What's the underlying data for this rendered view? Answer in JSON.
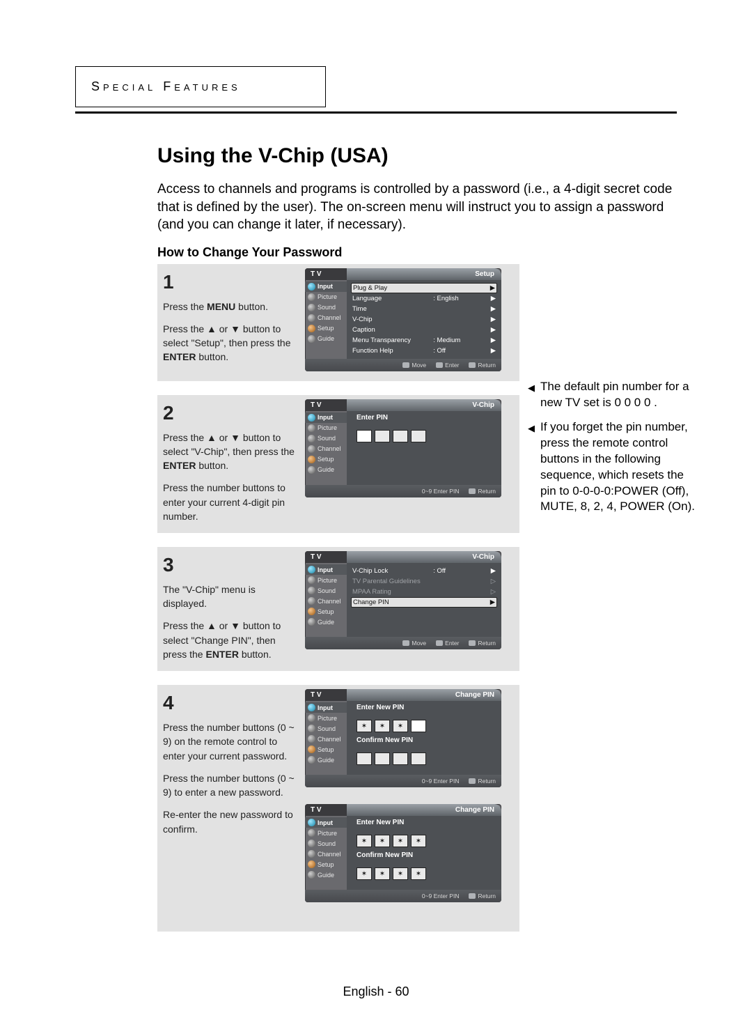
{
  "header": {
    "tab": "Special Features"
  },
  "title": "Using the V-Chip (USA)",
  "intro": "Access to channels and programs is controlled by a password (i.e., a 4-digit secret code that is defined by the user). The on-screen menu will instruct you to assign a password (and you can change it later, if necessary).",
  "subtitle": "How to Change Your Password",
  "osd_common": {
    "tv": "T V",
    "side": {
      "input": "Input",
      "picture": "Picture",
      "sound": "Sound",
      "channel": "Channel",
      "setup": "Setup",
      "guide": "Guide"
    },
    "footer": {
      "move": "Move",
      "enter": "Enter",
      "return": "Return",
      "number": "0~9 Enter PIN"
    }
  },
  "steps": [
    {
      "num": "1",
      "text_a": "Press the ",
      "text_a_bold": "MENU",
      "text_a_end": " button.",
      "text_b": "Press the ▲ or ▼ button to select \"Setup\", then press the ",
      "text_b_bold": "ENTER",
      "text_b_end": " button.",
      "osd_title": "Setup",
      "menu": [
        {
          "label": "Plug & Play",
          "value": "",
          "sel": true
        },
        {
          "label": "Language",
          "value": ": English"
        },
        {
          "label": "Time",
          "value": ""
        },
        {
          "label": "V-Chip",
          "value": ""
        },
        {
          "label": "Caption",
          "value": ""
        },
        {
          "label": "Menu Transparency",
          "value": ": Medium"
        },
        {
          "label": "Function Help",
          "value": ": Off"
        }
      ]
    },
    {
      "num": "2",
      "text_a": "Press the ▲ or ▼ button to select \"V-Chip\", then press the ",
      "text_a_bold": "ENTER",
      "text_a_end": " button.",
      "text_b": "Press the number buttons to enter your current 4-digit pin number.",
      "osd_title": "V-Chip",
      "enter_pin_label": "Enter PIN"
    },
    {
      "num": "3",
      "text_a": "The \"V-Chip\" menu is displayed.",
      "text_b": "Press the ▲ or ▼ button to select \"Change PIN\", then press the ",
      "text_b_bold": "ENTER",
      "text_b_end": " button.",
      "osd_title": "V-Chip",
      "menu": [
        {
          "label": "V-Chip Lock",
          "value": ": Off"
        },
        {
          "label": "TV Parental Guidelines",
          "value": "",
          "dis": true
        },
        {
          "label": "MPAA Rating",
          "value": "",
          "dis": true
        },
        {
          "label": "Change PIN",
          "value": "",
          "sel": true
        }
      ]
    },
    {
      "num": "4",
      "text_a": "Press the number buttons (0 ~ 9) on the remote control to enter your current password.",
      "text_b": "Press the number buttons (0 ~ 9) to enter a new password.",
      "text_c": "Re-enter the new password to confirm.",
      "osd_title": "Change PIN",
      "enter_new_label": "Enter New PIN",
      "confirm_new_label": "Confirm New PIN",
      "star": "✶"
    }
  ],
  "notes": [
    "The default pin number for a new TV set is  0 0 0 0 .",
    "If you forget the pin number, press the remote control buttons in the following sequence, which resets the pin to 0-0-0-0:POWER (Off), MUTE, 8, 2, 4, POWER (On)."
  ],
  "footer": "English - 60"
}
